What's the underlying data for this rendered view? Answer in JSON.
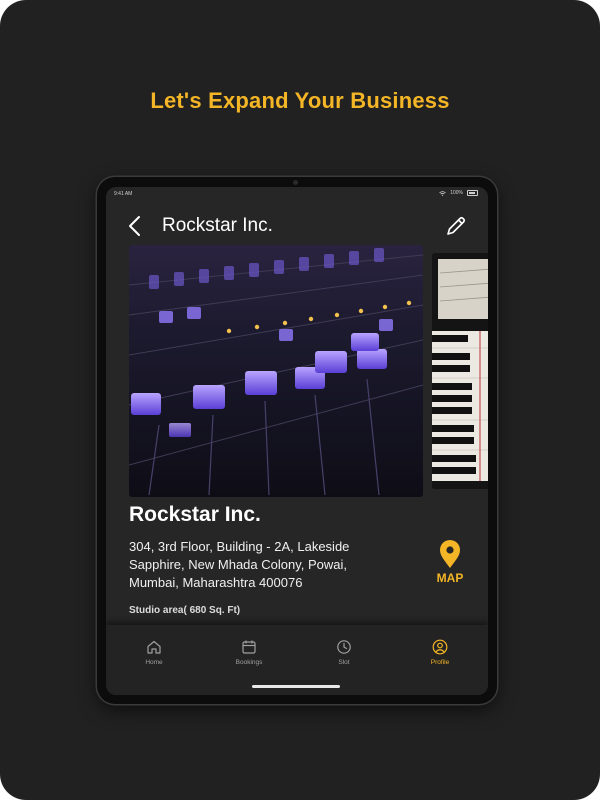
{
  "headline": "Let's Expand Your Business",
  "status": {
    "time": "9:41 AM",
    "battery": "100%"
  },
  "header": {
    "title": "Rockstar Inc."
  },
  "business": {
    "name": "Rockstar Inc.",
    "address": "304, 3rd Floor, Building - 2A, Lakeside Sapphire, New Mhada Colony, Powai, Mumbai, Maharashtra 400076",
    "map_label": "MAP",
    "studio_area": "Studio area( 680 Sq. Ft)"
  },
  "tabs": [
    {
      "label": "Home",
      "icon": "home-icon",
      "active": false
    },
    {
      "label": "Bookings",
      "icon": "calendar-icon",
      "active": false
    },
    {
      "label": "Slot",
      "icon": "clock-icon",
      "active": false
    },
    {
      "label": "Profile",
      "icon": "profile-icon",
      "active": true
    }
  ],
  "colors": {
    "accent": "#f4b526",
    "background": "#212121",
    "screen": "#262626"
  }
}
